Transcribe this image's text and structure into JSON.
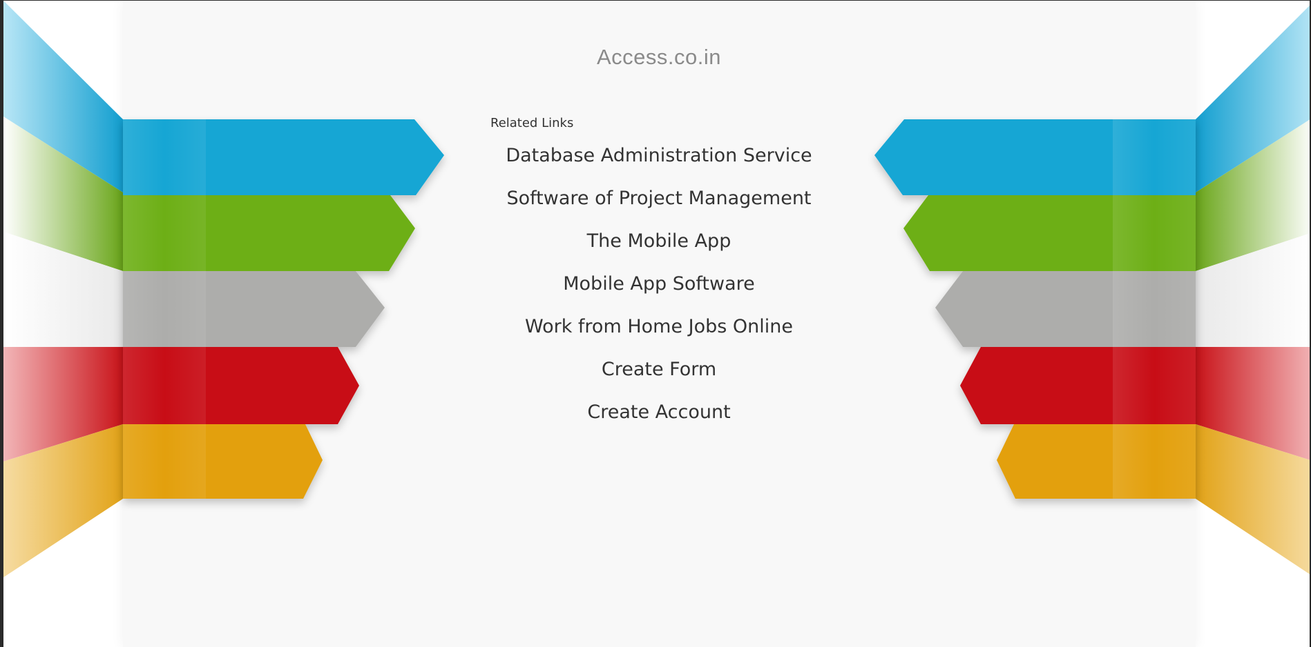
{
  "site": {
    "title": "Access.co.in"
  },
  "related": {
    "heading": "Related Links",
    "links": [
      "Database Administration Service",
      "Software of Project Management",
      "The Mobile App",
      "Mobile App Software",
      "Work from Home Jobs Online",
      "Create Form",
      "Create Account"
    ]
  },
  "colors": {
    "blue": "#12a6d4",
    "green": "#6daf12",
    "gray": "#adadab",
    "red": "#c81012",
    "yellow": "#e3a011",
    "panel": "#f8f8f8"
  }
}
